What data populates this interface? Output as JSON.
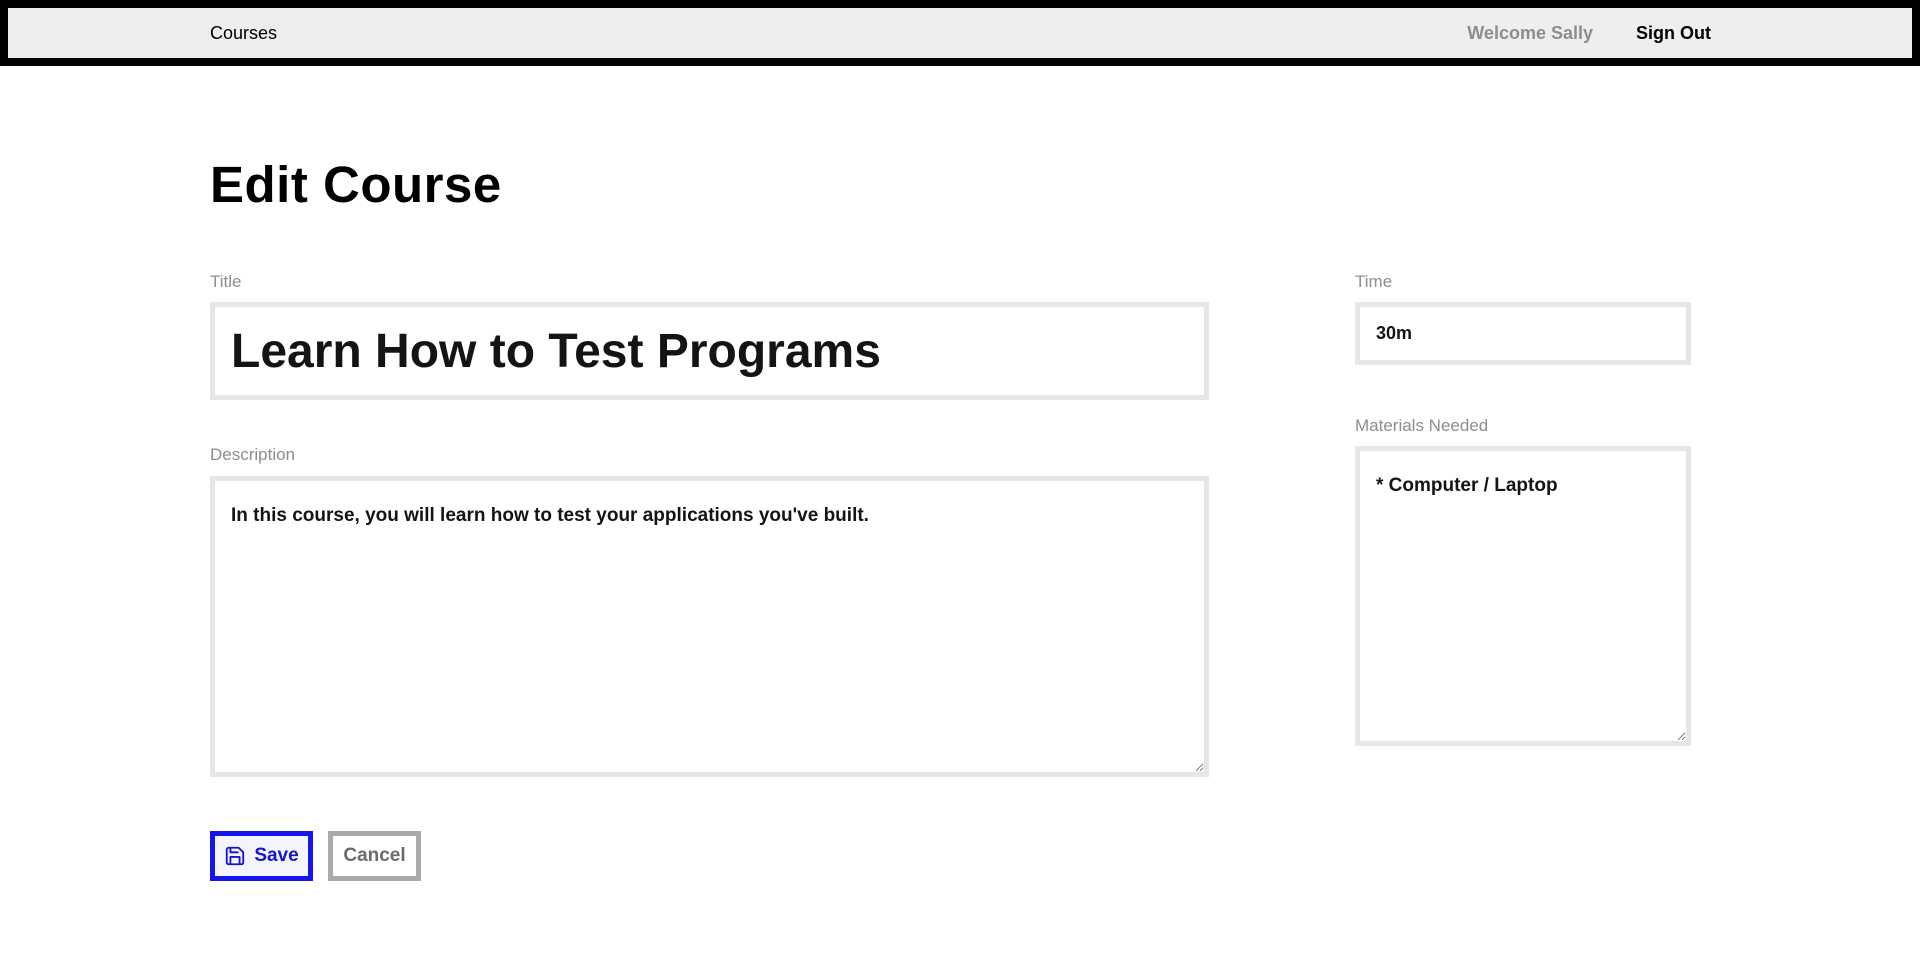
{
  "header": {
    "courses_link": "Courses",
    "welcome_text": "Welcome Sally",
    "signout_link": "Sign Out"
  },
  "page": {
    "title": "Edit Course"
  },
  "form": {
    "title_label": "Title",
    "title_value": "Learn How to Test Programs",
    "description_label": "Description",
    "description_value": "In this course, you will learn how to test your applications you've built.",
    "time_label": "Time",
    "time_value": "30m",
    "materials_label": "Materials Needed",
    "materials_value": "* Computer / Laptop"
  },
  "buttons": {
    "save_label": "Save",
    "cancel_label": "Cancel"
  },
  "icons": {
    "save": "floppy-disk-icon"
  },
  "colors": {
    "primary": "#1515ee",
    "header_bg": "#eeeeee",
    "header_border": "#000000",
    "muted_text": "#8d8d8d",
    "field_border": "#e6e6e6",
    "cancel_border": "#a9a9a9"
  }
}
